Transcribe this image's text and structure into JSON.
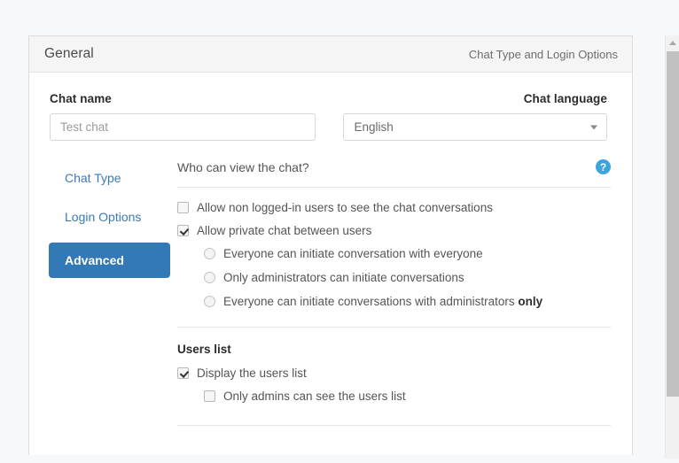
{
  "panel": {
    "header": {
      "title": "General",
      "subtitle": "Chat Type and Login Options"
    },
    "chat_name": {
      "label": "Chat name",
      "value": "Test chat",
      "placeholder": "Test chat"
    },
    "chat_language": {
      "label": "Chat language",
      "selected": "English",
      "caret_icon": "chevron-down-icon"
    },
    "side_nav": {
      "items": [
        {
          "label": "Chat Type",
          "active": false
        },
        {
          "label": "Login Options",
          "active": false
        },
        {
          "label": "Advanced",
          "active": true
        }
      ]
    },
    "visibility_section": {
      "question": "Who can view the chat?",
      "help_icon": "help-circle-icon",
      "help_label": "?",
      "checkboxes": [
        {
          "label": "Allow non logged-in users to see the chat conversations",
          "checked": false
        },
        {
          "label": "Allow private chat between users",
          "checked": true
        }
      ],
      "radios": [
        {
          "label": "Everyone can initiate conversation with everyone",
          "selected": false
        },
        {
          "label": "Only administrators can initiate conversations",
          "selected": false
        },
        {
          "label_prefix": "Everyone can initiate conversations with administrators ",
          "label_bold": "only",
          "selected": false
        }
      ]
    },
    "users_list_section": {
      "title": "Users list",
      "checkboxes": [
        {
          "label": "Display the users list",
          "checked": true
        },
        {
          "label": "Only admins can see the users list",
          "checked": false
        }
      ]
    }
  },
  "scrollbar": {
    "up_arrow_icon": "chevron-up-icon"
  },
  "colors": {
    "accent": "#3279b6",
    "link": "#3a7ab8",
    "help": "#3ba3e0",
    "page_bg": "#f7f8fa"
  }
}
